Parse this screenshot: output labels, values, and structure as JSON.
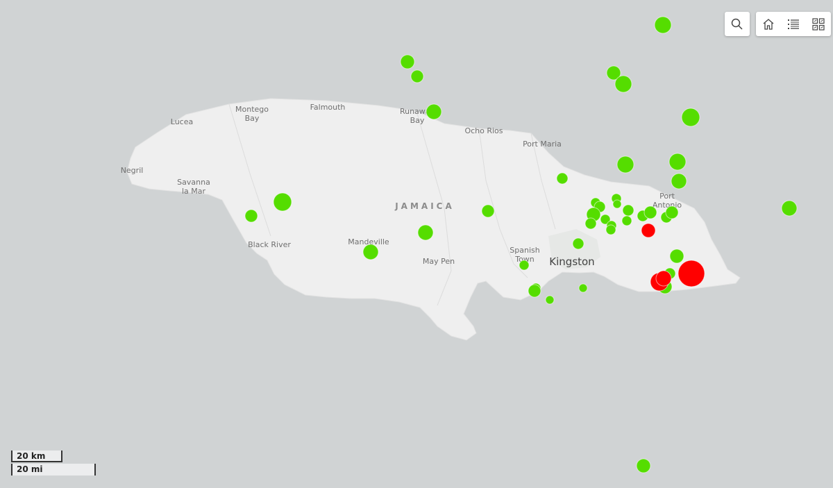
{
  "map": {
    "island_label": "JAMAICA",
    "places": [
      {
        "id": "montego-bay-1",
        "text": "Montego"
      },
      {
        "id": "montego-bay-2",
        "text": "Bay"
      },
      {
        "id": "falmouth",
        "text": "Falmouth"
      },
      {
        "id": "runaway-bay-1",
        "text": "Runaway"
      },
      {
        "id": "runaway-bay-2",
        "text": "Bay"
      },
      {
        "id": "lucea",
        "text": "Lucea"
      },
      {
        "id": "ocho-rios",
        "text": "Ocho Rios"
      },
      {
        "id": "port-maria",
        "text": "Port Maria"
      },
      {
        "id": "negril",
        "text": "Negril"
      },
      {
        "id": "savanna-la-mar-1",
        "text": "Savanna"
      },
      {
        "id": "savanna-la-mar-2",
        "text": "la Mar"
      },
      {
        "id": "port-antonio-1",
        "text": "Port"
      },
      {
        "id": "port-antonio-2",
        "text": "Antonio"
      },
      {
        "id": "black-river",
        "text": "Black River"
      },
      {
        "id": "mandeville",
        "text": "Mandeville"
      },
      {
        "id": "may-pen",
        "text": "May Pen"
      },
      {
        "id": "spanish-town-1",
        "text": "Spanish"
      },
      {
        "id": "spanish-town-2",
        "text": "Town"
      }
    ],
    "capital": "Kingston",
    "colors": {
      "water": "#d0d3d4",
      "land": "#efefef",
      "marker_low": "#55dd00",
      "marker_high": "#ff0000"
    }
  },
  "toolbar": {
    "search_icon": "search-icon",
    "home_icon": "home-icon",
    "legend_icon": "list-icon",
    "basemap_icon": "basemap-gallery-icon"
  },
  "scalebar": {
    "km_label": "20 km",
    "mi_label": "20 mi"
  }
}
